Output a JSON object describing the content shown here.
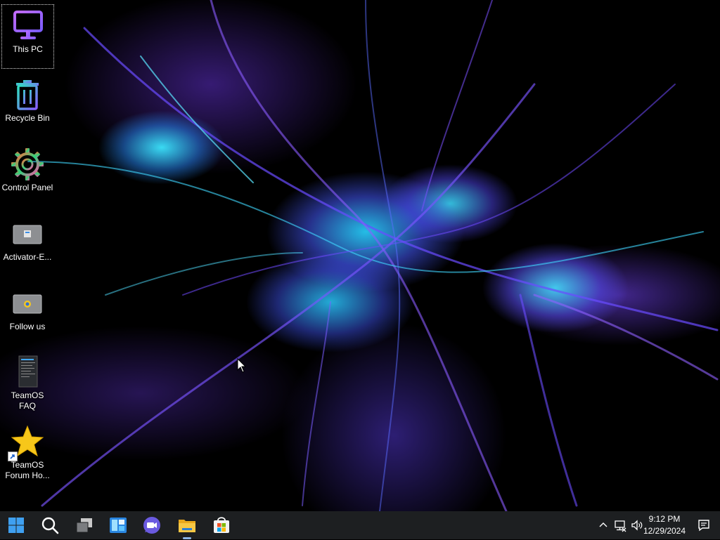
{
  "desktop": {
    "icons": [
      {
        "label": "This PC",
        "icon": "monitor-icon"
      },
      {
        "label": "Recycle Bin",
        "icon": "recycle-bin-icon"
      },
      {
        "label": "Control Panel",
        "icon": "gear-icon"
      },
      {
        "label": "Activator-E...",
        "icon": "shortcut-thumbnail-icon"
      },
      {
        "label": "Follow us",
        "icon": "shortcut-thumbnail-icon"
      },
      {
        "label": "TeamOS FAQ",
        "icon": "document-thumbnail-icon"
      },
      {
        "label": "TeamOS Forum Ho...",
        "icon": "star-icon"
      }
    ]
  },
  "taskbar": {
    "buttons": [
      "start-icon",
      "search-icon",
      "task-view-icon",
      "widgets-icon",
      "chat-icon",
      "file-explorer-icon",
      "store-icon"
    ],
    "tray": [
      "chevron-up-icon",
      "network-icon",
      "volume-icon"
    ],
    "clock": {
      "time": "9:12 PM",
      "date": "12/29/2024"
    },
    "notification_icon": "notification-icon"
  },
  "colors": {
    "taskbar": "#1d1f21",
    "accent": "#3a8ee6"
  }
}
